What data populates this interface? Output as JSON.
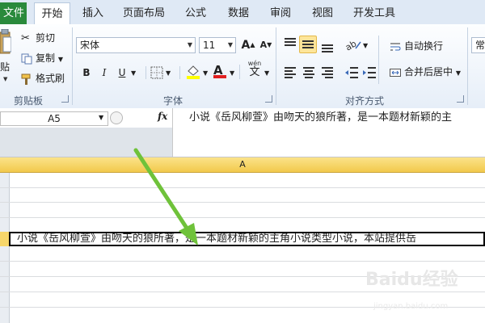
{
  "tabs": {
    "file": "文件",
    "items": [
      "开始",
      "插入",
      "页面布局",
      "公式",
      "数据",
      "审阅",
      "视图",
      "开发工具"
    ]
  },
  "clipboard": {
    "paste_label": "贴",
    "cut": "剪切",
    "copy": "复制",
    "format_painter": "格式刷",
    "group_label": "剪贴板"
  },
  "font": {
    "name": "宋体",
    "size": "11",
    "bold": "B",
    "italic": "I",
    "underline": "U",
    "grow": "A",
    "shrink": "A",
    "wen": "wén",
    "wen_char": "文",
    "group_label": "字体"
  },
  "alignment": {
    "wrap_text": "自动换行",
    "merge_center": "合并后居中",
    "group_label": "对齐方式"
  },
  "number": {
    "format": "常"
  },
  "formula_bar": {
    "name_box": "A5",
    "fx": "fx",
    "content": "小说《岳风柳萱》由吻天的狼所著，是一本题材新颖的主"
  },
  "grid": {
    "column_a": "A",
    "a5_text": "小说《岳风柳萱》由吻天的狼所著，是一本题材新颖的主角小说类型小说，本站提供岳"
  },
  "watermark": {
    "brand": "Baidu经验",
    "url": "jingyan.baidu.com"
  },
  "colors": {
    "file_tab": "#2a8a3c",
    "selected_col_header": "#f2c94c",
    "annotation_arrow": "#7fcf3a"
  }
}
